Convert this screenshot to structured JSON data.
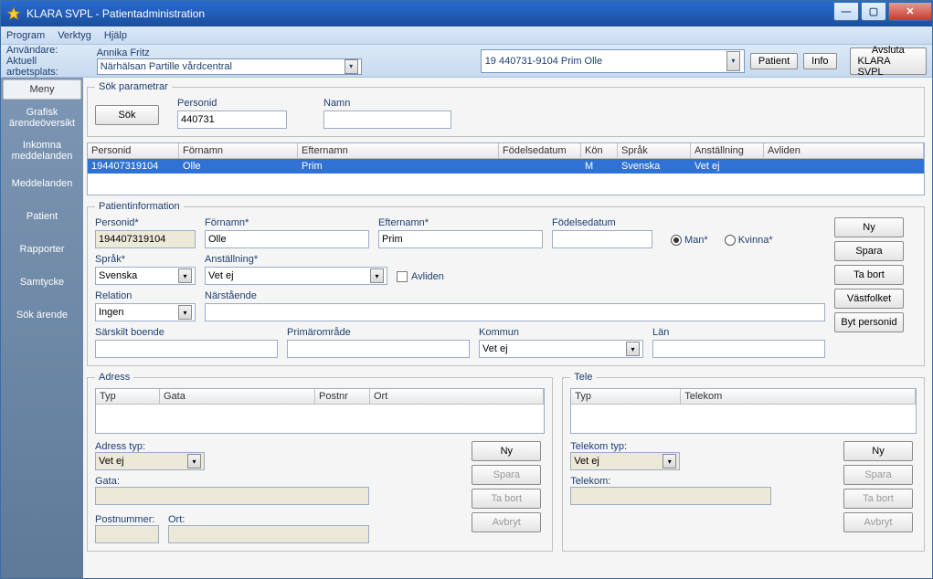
{
  "window": {
    "title": "KLARA SVPL - Patientadministration"
  },
  "menu": {
    "program": "Program",
    "verktyg": "Verktyg",
    "hjalp": "Hjälp"
  },
  "infobar": {
    "user_label": "Användare:",
    "user_value": "Annika Fritz",
    "workplace_label": "Aktuell arbetsplats:",
    "workplace_value": "Närhälsan Partille vårdcentral",
    "patient_combo": "19 440731-9104 Prim Olle",
    "patient_btn": "Patient",
    "info_btn": "Info",
    "exit_line1": "Avsluta",
    "exit_line2": "KLARA SVPL"
  },
  "sidebar": {
    "header": "Meny",
    "items": [
      "Grafisk ärendeöversikt",
      "Inkomna meddelanden",
      "Meddelanden",
      "Patient",
      "Rapporter",
      "Samtycke",
      "Sök ärende"
    ]
  },
  "sok": {
    "legend": "Sök parametrar",
    "sok_btn": "Sök",
    "personid_label": "Personid",
    "personid_value": "440731",
    "namn_label": "Namn",
    "namn_value": ""
  },
  "results": {
    "headers": {
      "personid": "Personid",
      "fornamn": "Förnamn",
      "efternamn": "Efternamn",
      "fodelsedatum": "Födelsedatum",
      "kon": "Kön",
      "sprak": "Språk",
      "anstallning": "Anställning",
      "avliden": "Avliden"
    },
    "row": {
      "personid": "194407319104",
      "fornamn": "Olle",
      "efternamn": "Prim",
      "fodelsedatum": "",
      "kon": "M",
      "sprak": "Svenska",
      "anstallning": "Vet ej",
      "avliden": ""
    }
  },
  "patient": {
    "legend": "Patientinformation",
    "labels": {
      "personid": "Personid*",
      "fornamn": "Förnamn*",
      "efternamn": "Efternamn*",
      "fodelsedatum": "Födelsedatum",
      "man": "Man*",
      "kvinna": "Kvinna*",
      "sprak": "Språk*",
      "anstallning": "Anställning*",
      "avliden": "Avliden",
      "relation": "Relation",
      "narstaende": "Närstående",
      "sarskilt": "Särskilt boende",
      "primaromrade": "Primärområde",
      "kommun": "Kommun",
      "lan": "Län"
    },
    "values": {
      "personid": "194407319104",
      "fornamn": "Olle",
      "efternamn": "Prim",
      "fodelsedatum": "",
      "sprak": "Svenska",
      "anstallning": "Vet ej",
      "relation": "Ingen",
      "narstaende": "",
      "sarskilt": "",
      "primaromrade": "",
      "kommun": "Vet ej",
      "lan": ""
    },
    "buttons": {
      "ny": "Ny",
      "spara": "Spara",
      "tabort": "Ta bort",
      "vastfolket": "Västfolket",
      "bytpersonid": "Byt personid"
    }
  },
  "adress": {
    "legend": "Adress",
    "headers": {
      "typ": "Typ",
      "gata": "Gata",
      "postnr": "Postnr",
      "ort": "Ort"
    },
    "labels": {
      "adress_typ": "Adress typ:",
      "gata": "Gata:",
      "postnummer": "Postnummer:",
      "ort": "Ort:"
    },
    "values": {
      "adress_typ": "Vet ej",
      "gata": "",
      "postnummer": "",
      "ort": ""
    },
    "buttons": {
      "ny": "Ny",
      "spara": "Spara",
      "tabort": "Ta bort",
      "avbryt": "Avbryt"
    }
  },
  "tele": {
    "legend": "Tele",
    "headers": {
      "typ": "Typ",
      "telekom": "Telekom"
    },
    "labels": {
      "telekom_typ": "Telekom typ:",
      "telekom": "Telekom:"
    },
    "values": {
      "telekom_typ": "Vet ej",
      "telekom": ""
    },
    "buttons": {
      "ny": "Ny",
      "spara": "Spara",
      "tabort": "Ta bort",
      "avbryt": "Avbryt"
    }
  }
}
